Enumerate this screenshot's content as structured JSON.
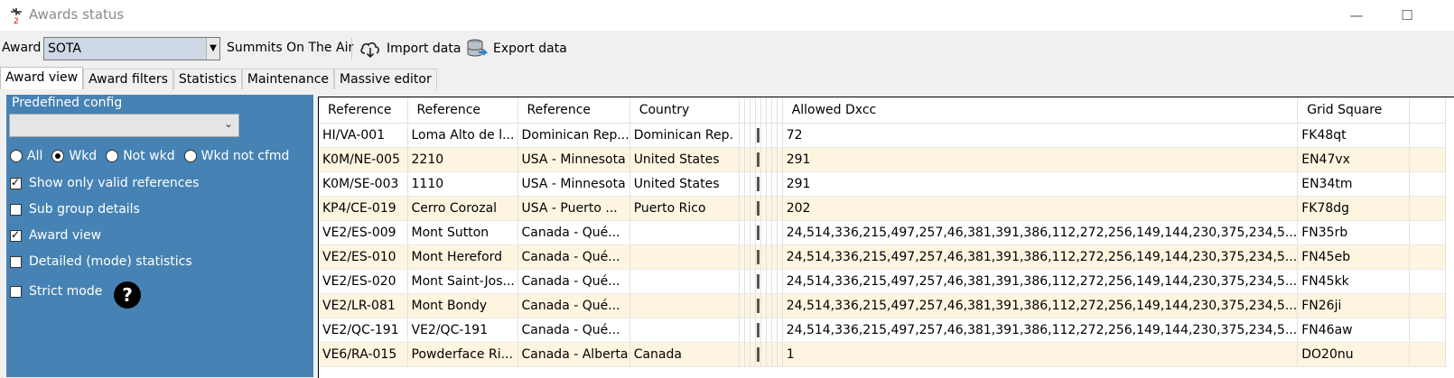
{
  "window": {
    "title": "Awards status",
    "minimize": "—",
    "maximize": "☐"
  },
  "toolbar": {
    "award_label": "Award",
    "award_value": "SOTA",
    "award_name": "Summits On The Air",
    "import_label": "Import data",
    "export_label": "Export data"
  },
  "tabs": [
    "Award view",
    "Award filters",
    "Statistics",
    "Maintenance",
    "Massive editor"
  ],
  "left": {
    "predef_label": "Predefined config",
    "predef_value": "",
    "radios": [
      {
        "label": "All",
        "checked": false
      },
      {
        "label": "Wkd",
        "checked": true
      },
      {
        "label": "Not wkd",
        "checked": false
      },
      {
        "label": "Wkd not cfmd",
        "checked": false
      }
    ],
    "checks": [
      {
        "label": "Show only valid references",
        "checked": true
      },
      {
        "label": "Sub group details",
        "checked": false
      },
      {
        "label": "Award view",
        "checked": true
      },
      {
        "label": "Detailed (mode) statistics",
        "checked": false
      },
      {
        "label": "Strict mode",
        "checked": false
      }
    ],
    "help_glyph": "?"
  },
  "grid": {
    "headers": [
      "Reference",
      "Reference",
      "Reference",
      "Country",
      "Allowed Dxcc",
      "Grid Square"
    ],
    "rows": [
      [
        "HI/VA-001",
        "Loma Alto de l...",
        "Dominican Rep...",
        "Dominican Rep.",
        "72",
        "FK48qt"
      ],
      [
        "K0M/NE-005",
        "2210",
        "USA - Minnesota",
        "United States",
        "291",
        "EN47vx"
      ],
      [
        "K0M/SE-003",
        "1110",
        "USA - Minnesota",
        "United States",
        "291",
        "EN34tm"
      ],
      [
        "KP4/CE-019",
        "Cerro Corozal",
        "USA - Puerto ...",
        "Puerto Rico",
        "202",
        "FK78dg"
      ],
      [
        "VE2/ES-009",
        "Mont Sutton",
        "Canada - Qué...",
        "",
        "24,514,336,215,497,257,46,381,391,386,112,272,256,149,144,230,375,234,5...",
        "FN35rb"
      ],
      [
        "VE2/ES-010",
        "Mont Hereford",
        "Canada - Qué...",
        "",
        "24,514,336,215,497,257,46,381,391,386,112,272,256,149,144,230,375,234,5...",
        "FN45eb"
      ],
      [
        "VE2/ES-020",
        "Mont Saint-Jos...",
        "Canada - Qué...",
        "",
        "24,514,336,215,497,257,46,381,391,386,112,272,256,149,144,230,375,234,5...",
        "FN45kk"
      ],
      [
        "VE2/LR-081",
        "Mont Bondy",
        "Canada - Qué...",
        "",
        "24,514,336,215,497,257,46,381,391,386,112,272,256,149,144,230,375,234,5...",
        "FN26ji"
      ],
      [
        "VE2/QC-191",
        "VE2/QC-191",
        "Canada - Qué...",
        "",
        "24,514,336,215,497,257,46,381,391,386,112,272,256,149,144,230,375,234,5...",
        "FN46aw"
      ],
      [
        "VE6/RA-015",
        "Powderface Ri...",
        "Canada - Alberta",
        "Canada",
        "1",
        "DO20nu"
      ]
    ]
  },
  "colors": {
    "panel": "#4683b4",
    "row_alt": "#fdf5e0",
    "combo_selected": "#cfd8e6"
  }
}
